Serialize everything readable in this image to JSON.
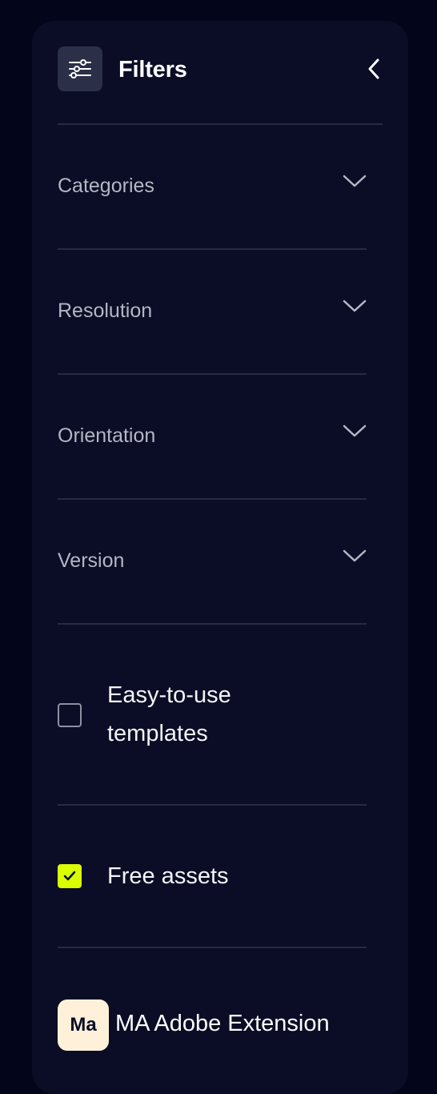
{
  "header": {
    "title": "Filters",
    "filter_icon": "sliders-icon",
    "collapse_icon": "chevron-left-icon"
  },
  "accordions": [
    {
      "label": "Categories",
      "icon": "chevron-down-icon",
      "expanded": false
    },
    {
      "label": "Resolution",
      "icon": "chevron-down-icon",
      "expanded": false
    },
    {
      "label": "Orientation",
      "icon": "chevron-down-icon",
      "expanded": false
    },
    {
      "label": "Version",
      "icon": "chevron-down-icon",
      "expanded": false
    }
  ],
  "checkboxes": [
    {
      "label_line1": "Easy-to-use",
      "label_line2": "templates",
      "checked": false
    },
    {
      "label": "Free assets",
      "checked": true
    }
  ],
  "extension": {
    "logo_text": "Ma",
    "label": "MA Adobe Extension"
  },
  "colors": {
    "background": "#03051a",
    "panel": "#0a0d25",
    "accent": "#d9ff00",
    "logo_bg": "#fff1d9"
  }
}
